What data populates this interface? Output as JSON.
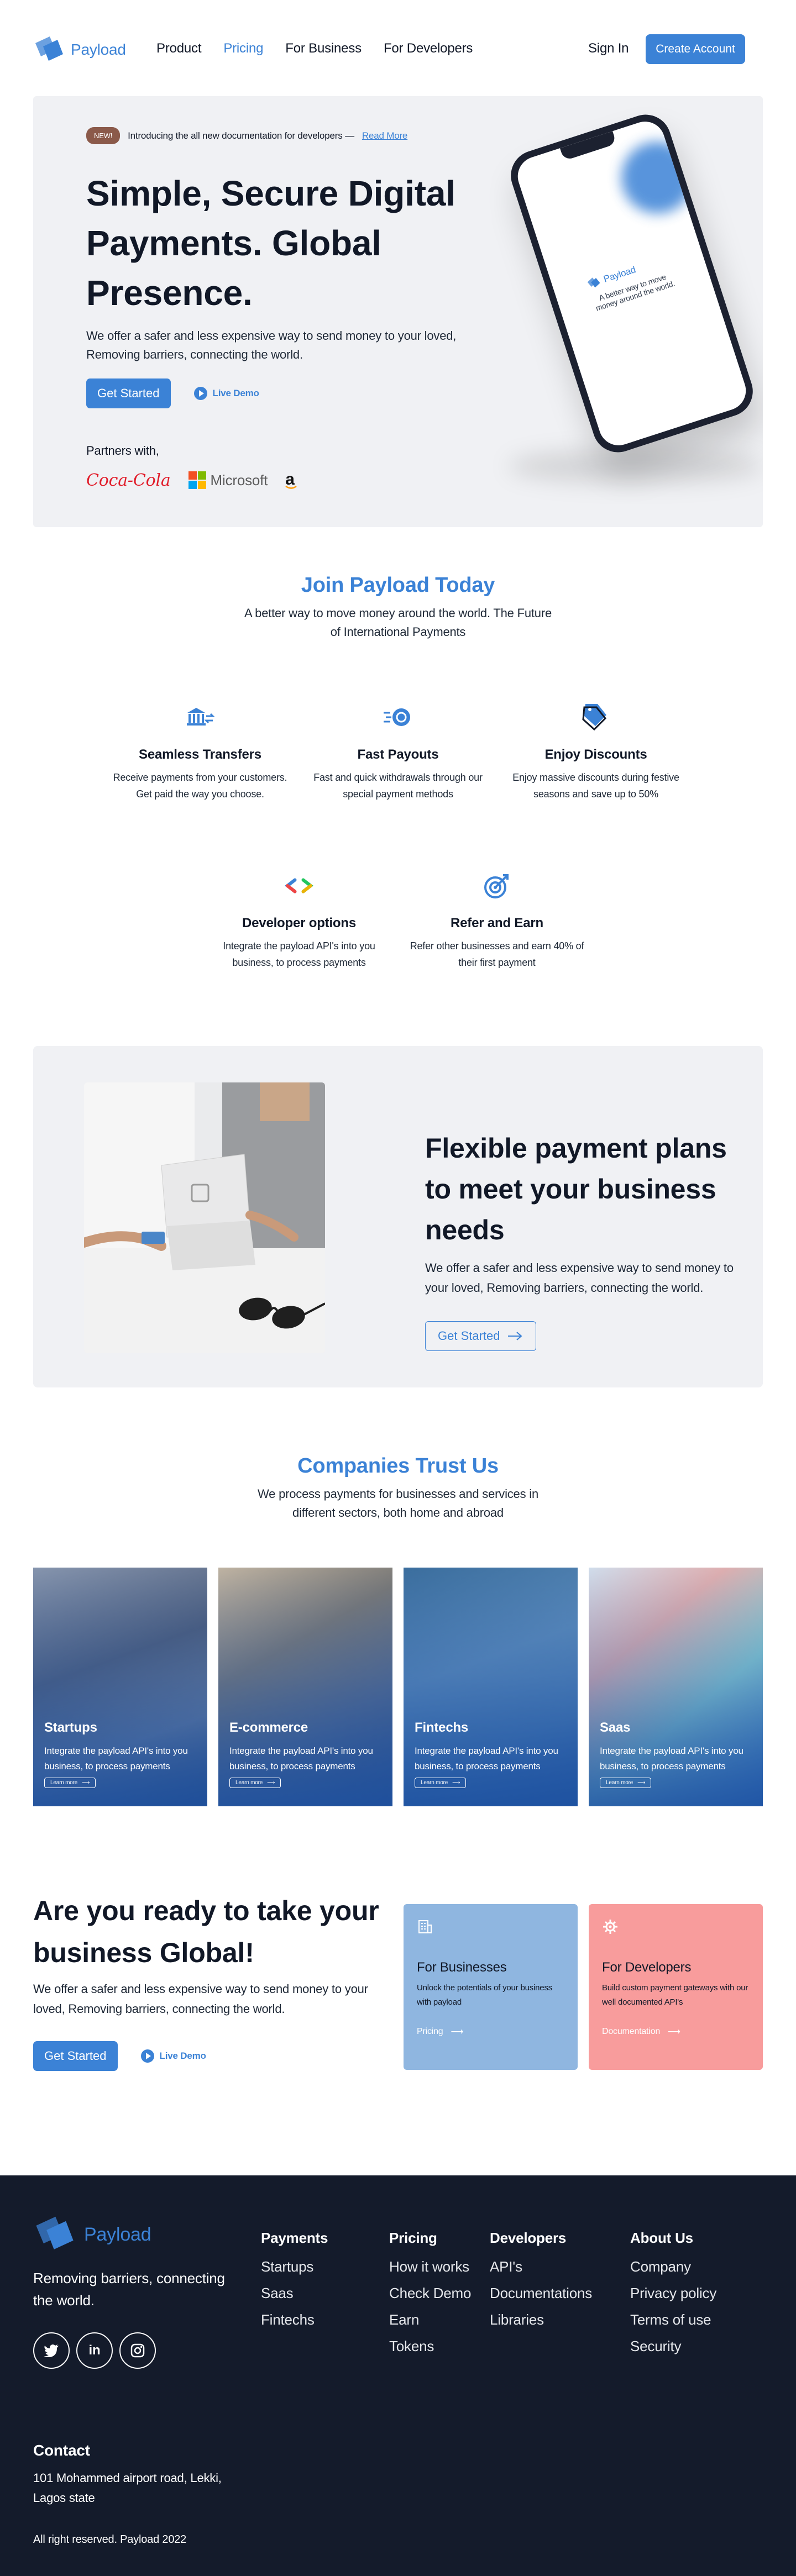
{
  "brand": {
    "name": "Payload",
    "accent": "#3b82d6"
  },
  "nav": {
    "links": [
      {
        "label": "Product",
        "active": false
      },
      {
        "label": "Pricing",
        "active": true
      },
      {
        "label": "For Business",
        "active": false
      },
      {
        "label": "For Developers",
        "active": false
      }
    ],
    "signin": "Sign In",
    "create_account": "Create Account"
  },
  "hero": {
    "badge": "NEW!",
    "announcement": "Introducing the all new documentation for developers —",
    "read_more": "Read More",
    "title_line1": "Simple, Secure Digital",
    "title_line2": "Payments. Global Presence.",
    "subtitle": "We offer a safer and less expensive way to send money to your loved, Removing barriers, connecting the world.",
    "cta": "Get Started",
    "demo": "Live Demo",
    "partners_label": "Partners with,",
    "partners": [
      "Coca-Cola",
      "Microsoft",
      "a"
    ],
    "phone_logo": "Payload",
    "phone_tagline": "A better way to move money around the world."
  },
  "join": {
    "title": "Join Payload Today",
    "subtitle": "A better way to move money around the world. The Future of International Payments",
    "features": [
      {
        "icon": "bank-transfer-icon",
        "title": "Seamless Transfers",
        "desc": "Receive payments from your customers. Get paid the way you choose."
      },
      {
        "icon": "fast-payout-icon",
        "title": "Fast Payouts",
        "desc": "Fast and quick withdrawals through our special payment methods"
      },
      {
        "icon": "discount-tag-icon",
        "title": "Enjoy Discounts",
        "desc": "Enjoy massive discounts during festive seasons and save up to 50%"
      },
      {
        "icon": "code-brackets-icon",
        "title": "Developer options",
        "desc": "Integrate the payload API's into you business, to process payments"
      },
      {
        "icon": "target-refer-icon",
        "title": "Refer and Earn",
        "desc": "Refer other businesses and earn 40% of their first payment"
      }
    ]
  },
  "plans": {
    "title": "Flexible payment plans to meet your business needs",
    "subtitle": "We offer a safer and less expensive way to send money to your loved, Removing barriers, connecting the world.",
    "cta": "Get Started"
  },
  "trust": {
    "title": "Companies Trust Us",
    "subtitle": "We process payments for businesses and services in different sectors, both home and abroad",
    "cards": [
      {
        "title": "Startups",
        "desc": "Integrate the payload API's into you business, to process payments",
        "button": "Learn more"
      },
      {
        "title": "E-commerce",
        "desc": "Integrate the payload API's into you business, to process payments",
        "button": "Learn more"
      },
      {
        "title": "Fintechs",
        "desc": "Integrate the payload API's into you business, to process payments",
        "button": "Learn more"
      },
      {
        "title": "Saas",
        "desc": "Integrate the payload API's into you business, to process payments",
        "button": "Learn more"
      }
    ]
  },
  "global": {
    "title": "Are you ready to take your business Global!",
    "subtitle": "We offer a safer and less expensive way to send money to your loved, Removing barriers, connecting the world.",
    "cta": "Get Started",
    "demo": "Live Demo",
    "business_card": {
      "title": "For Businesses",
      "desc": "Unlock the potentials of your business with payload",
      "link": "Pricing",
      "color": "#8fb6e0"
    },
    "developer_card": {
      "title": "For Developers",
      "desc": "Build custom payment gateways with our well documented API's",
      "link": "Documentation",
      "color": "#f89c9c"
    }
  },
  "footer": {
    "tagline": "Removing barriers, connecting the world.",
    "socials": [
      "twitter-icon",
      "linkedin-icon",
      "instagram-icon"
    ],
    "columns": [
      {
        "title": "Payments",
        "items": [
          "Startups",
          "Saas",
          "Fintechs"
        ]
      },
      {
        "title": "Pricing",
        "items": [
          "How it works",
          "Check Demo",
          "Earn",
          "Tokens"
        ]
      },
      {
        "title": "Developers",
        "items": [
          "API's",
          "Documentations",
          "Libraries"
        ]
      },
      {
        "title": "About Us",
        "items": [
          "Company",
          "Privacy policy",
          "Terms of use",
          "Security"
        ]
      }
    ],
    "contact_title": "Contact",
    "contact_address": "101 Mohammed airport road, Lekki, Lagos state",
    "copyright": "All right reserved. Payload 2022"
  }
}
